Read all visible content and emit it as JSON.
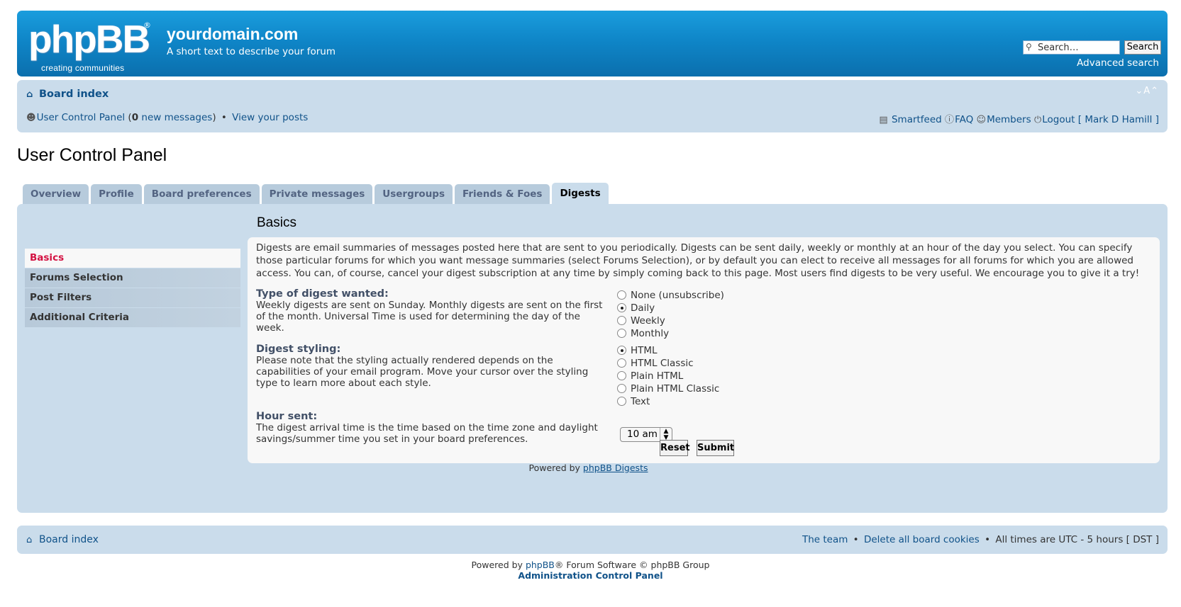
{
  "header": {
    "logo": {
      "main": "phpBB",
      "reg": "®",
      "tagline": "creating communities"
    },
    "site_name": "yourdomain.com",
    "site_description": "A short text to describe your forum",
    "search": {
      "placeholder": "Search…",
      "button": "Search",
      "advanced": "Advanced search"
    }
  },
  "navbar": {
    "breadcrumb": "Board index",
    "font_controls": "⌄A⌃",
    "left": {
      "ucp": "User Control Panel",
      "new_count": "0",
      "new_suffix": "new messages",
      "view_posts": "View your posts"
    },
    "right": {
      "smartfeed": "Smartfeed",
      "faq": "FAQ",
      "members": "Members",
      "logout": "Logout",
      "username": "Mark D Hamill"
    }
  },
  "page_title": "User Control Panel",
  "tabs": [
    "Overview",
    "Profile",
    "Board preferences",
    "Private messages",
    "Usergroups",
    "Friends & Foes",
    "Digests"
  ],
  "active_tab": "Digests",
  "sidebar": [
    "Basics",
    "Forums Selection",
    "Post Filters",
    "Additional Criteria"
  ],
  "section": {
    "title": "Basics",
    "intro": "Digests are email summaries of messages posted here that are sent to you periodically. Digests can be sent daily, weekly or monthly at an hour of the day you select. You can specify those particular forums for which you want message summaries (select Forums Selection), or by default you can elect to receive all messages for all forums for which you are allowed access. You can, of course, cancel your digest subscription at any time by simply coming back to this page. Most users find digests to be very useful. We encourage you to give it a try!",
    "digest_type": {
      "label": "Type of digest wanted:",
      "description": "Weekly digests are sent on Sunday. Monthly digests are sent on the first of the month. Universal Time is used for determining the day of the week.",
      "options": [
        "None (unsubscribe)",
        "Daily",
        "Weekly",
        "Monthly"
      ],
      "selected": "Daily"
    },
    "styling": {
      "label": "Digest styling:",
      "description": "Please note that the styling actually rendered depends on the capabilities of your email program. Move your cursor over the styling type to learn more about each style.",
      "options": [
        "HTML",
        "HTML Classic",
        "Plain HTML",
        "Plain HTML Classic",
        "Text"
      ],
      "selected": "HTML"
    },
    "hour": {
      "label": "Hour sent:",
      "description": "The digest arrival time is the time based on the time zone and daylight savings/summer time you set in your board preferences.",
      "value": "10 am"
    },
    "buttons": {
      "reset": "Reset",
      "submit": "Submit"
    },
    "powered_prefix": "Powered by",
    "powered_link": "phpBB Digests"
  },
  "footer": {
    "breadcrumb": "Board index",
    "team": "The team",
    "delete_cookies": "Delete all board cookies",
    "times": "All times are UTC - 5 hours [ DST ]",
    "powered_prefix": "Powered by",
    "phpbb": "phpBB",
    "powered_suffix": "® Forum Software © phpBB Group",
    "acp": "Administration Control Panel"
  },
  "colors": {
    "header_blue": "#0f86c8",
    "panel": "#cadceb",
    "link": "#105289",
    "active_side": "#d31141"
  }
}
